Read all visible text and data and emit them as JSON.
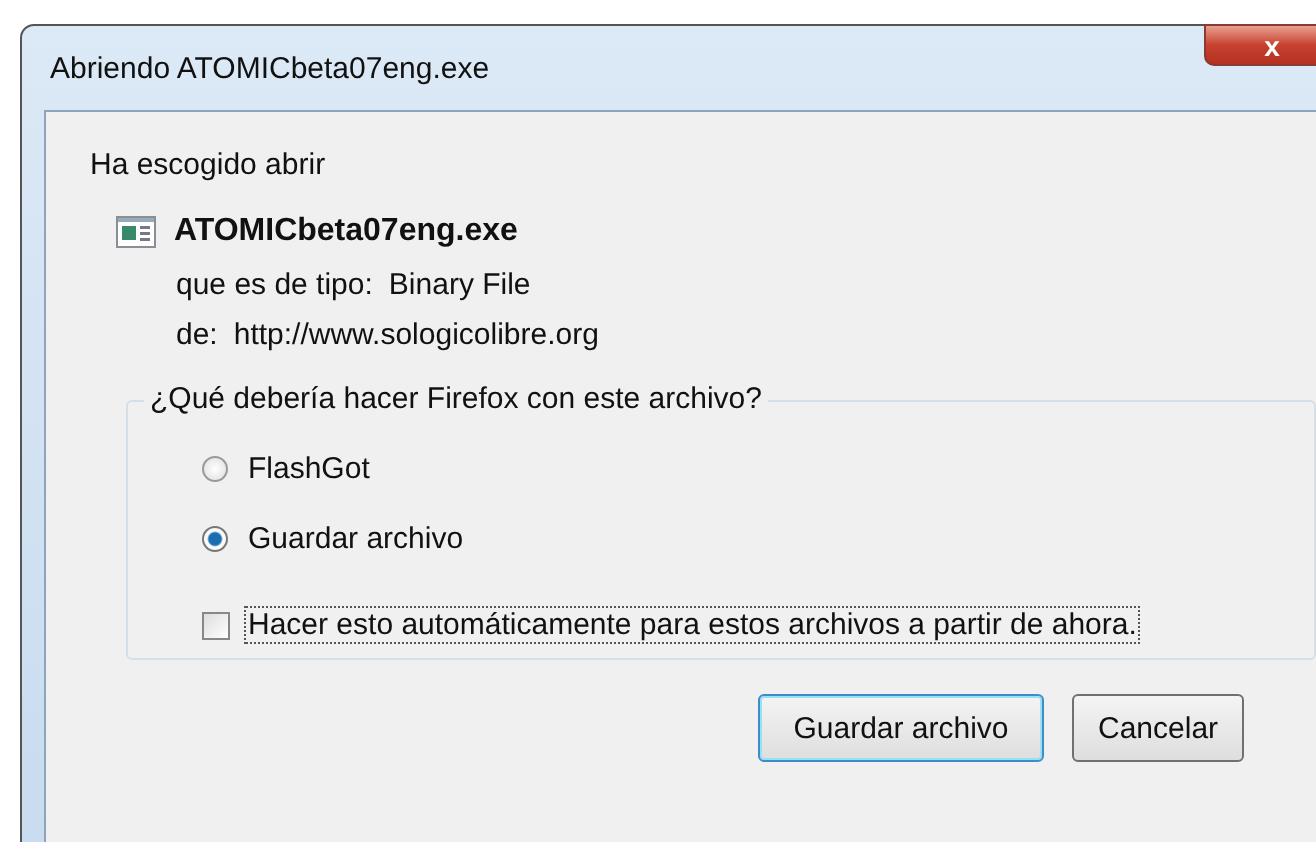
{
  "window": {
    "title": "Abriendo ATOMICbeta07eng.exe",
    "close_label": "x"
  },
  "intro": "Ha escogido abrir",
  "file": {
    "name": "ATOMICbeta07eng.exe",
    "type_label": "que es de tipo:",
    "type_value": "Binary File",
    "from_label": "de:",
    "from_value": "http://www.sologicolibre.org"
  },
  "group": {
    "legend": "¿Qué debería hacer Firefox con este archivo?",
    "options": [
      {
        "label": "FlashGot",
        "selected": false
      },
      {
        "label": "Guardar archivo",
        "selected": true
      }
    ],
    "remember": {
      "label": "Hacer esto automáticamente para estos archivos a partir de ahora.",
      "checked": false
    }
  },
  "buttons": [
    {
      "label": "Guardar archivo",
      "default": true
    },
    {
      "label": "Cancelar",
      "default": false
    }
  ]
}
